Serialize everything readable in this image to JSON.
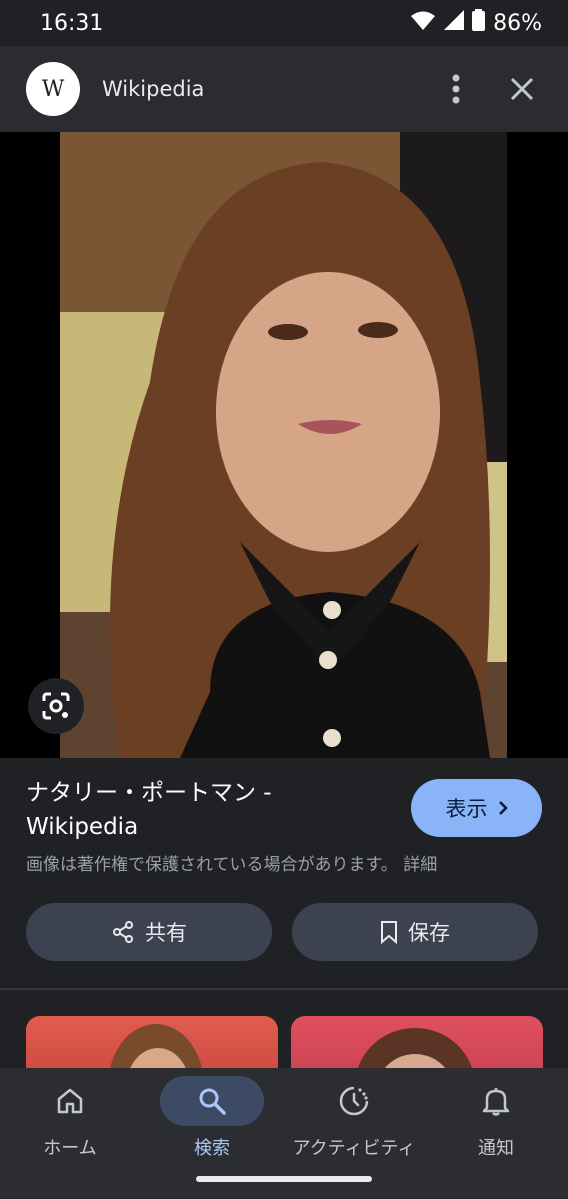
{
  "status_bar": {
    "time": "16:31",
    "battery": "86%"
  },
  "header": {
    "logo": "W",
    "title": "Wikipedia"
  },
  "result": {
    "title": "ナタリー・ポートマン - Wikipedia",
    "view_label": "表示",
    "copyright_note": "画像は著作権で保護されている場合があります。 詳細"
  },
  "actions": {
    "share_label": "共有",
    "save_label": "保存"
  },
  "bottom_nav": {
    "items": [
      {
        "label": "ホーム",
        "icon": "home-icon"
      },
      {
        "label": "検索",
        "icon": "search-icon",
        "active": true
      },
      {
        "label": "アクティビティ",
        "icon": "activity-icon"
      },
      {
        "label": "通知",
        "icon": "bell-icon"
      }
    ]
  },
  "colors": {
    "accent": "#8ab4f8",
    "background": "#1f2125",
    "nav_active": "#a8c7fa"
  }
}
